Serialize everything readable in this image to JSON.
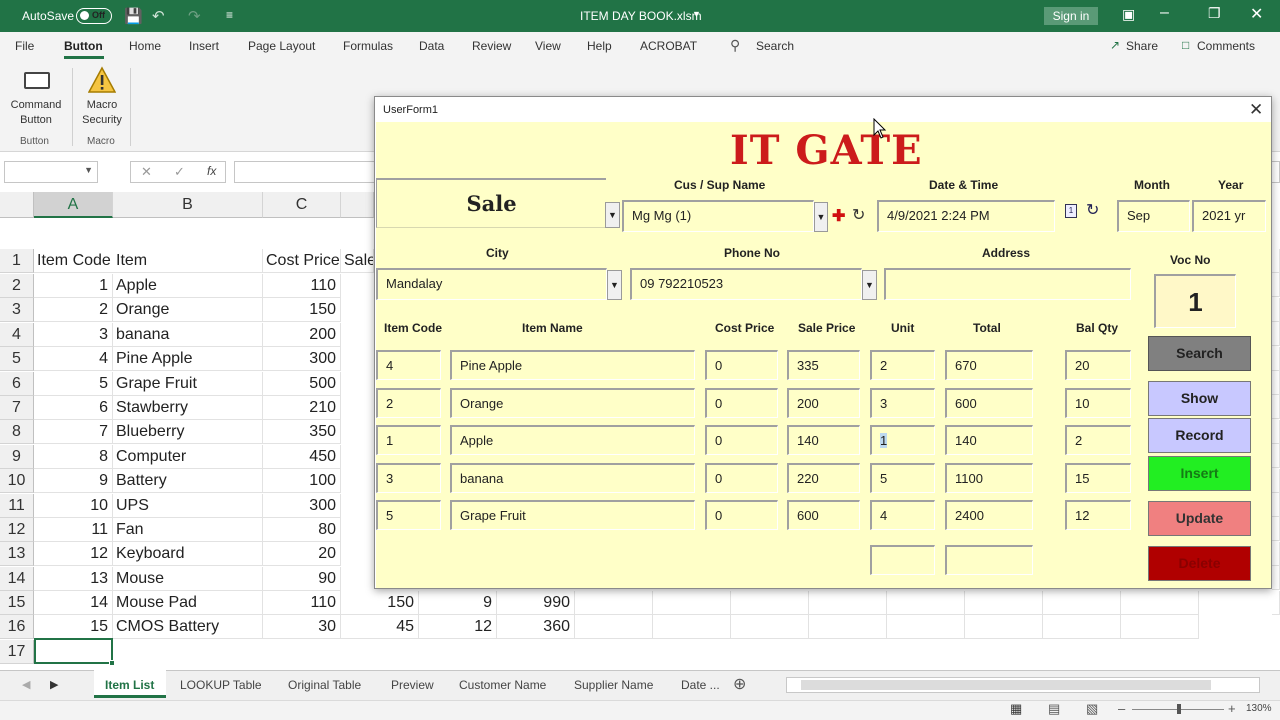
{
  "titlebar": {
    "autosave_label": "AutoSave",
    "autosave_state": "Off",
    "filename": "ITEM DAY BOOK.xlsm",
    "signin_label": "Sign in"
  },
  "ribbon_tabs": [
    "File",
    "Button",
    "Home",
    "Insert",
    "Page Layout",
    "Formulas",
    "Data",
    "Review",
    "View",
    "Help",
    "ACROBAT"
  ],
  "ribbon_search": "Search",
  "share_label": "Share",
  "comments_label": "Comments",
  "ribbon": {
    "command_button_label": "Command Button",
    "command_button_l1": "Command",
    "command_button_l2": "Button",
    "macro_security_l1": "Macro",
    "macro_security_l2": "Security",
    "group_button": "Button",
    "group_macro": "Macro"
  },
  "formula_bar": {
    "fx": "fx"
  },
  "columns": [
    "A",
    "B",
    "C"
  ],
  "col_d_header": "Sale",
  "header_row": {
    "a": "Item Code",
    "b": "Item",
    "c": "Cost Price"
  },
  "rows": [
    {
      "n": "2",
      "code": "1",
      "item": "Apple",
      "cost": "110"
    },
    {
      "n": "3",
      "code": "2",
      "item": "Orange",
      "cost": "150"
    },
    {
      "n": "4",
      "code": "3",
      "item": "banana",
      "cost": "200"
    },
    {
      "n": "5",
      "code": "4",
      "item": "Pine Apple",
      "cost": "300"
    },
    {
      "n": "6",
      "code": "5",
      "item": "Grape Fruit",
      "cost": "500"
    },
    {
      "n": "7",
      "code": "6",
      "item": "Stawberry",
      "cost": "210"
    },
    {
      "n": "8",
      "code": "7",
      "item": "Blueberry",
      "cost": "350"
    },
    {
      "n": "9",
      "code": "8",
      "item": "Computer",
      "cost": "450"
    },
    {
      "n": "10",
      "code": "9",
      "item": "Battery",
      "cost": "100"
    },
    {
      "n": "11",
      "code": "10",
      "item": "UPS",
      "cost": "300"
    },
    {
      "n": "12",
      "code": "11",
      "item": "Fan",
      "cost": "80"
    },
    {
      "n": "13",
      "code": "12",
      "item": "Keyboard",
      "cost": "20"
    },
    {
      "n": "14",
      "code": "13",
      "item": "Mouse",
      "cost": "90"
    }
  ],
  "rows_full": [
    {
      "n": "15",
      "code": "14",
      "item": "Mouse Pad",
      "cost": "110",
      "sale": "150",
      "qty": "9",
      "total": "990"
    },
    {
      "n": "16",
      "code": "15",
      "item": "CMOS Battery",
      "cost": "30",
      "sale": "45",
      "qty": "12",
      "total": "360"
    }
  ],
  "row_1": "1",
  "row_17": "17",
  "sheet_tabs": [
    "Item List",
    "LOOKUP Table",
    "Original Table",
    "Preview",
    "Customer Name",
    "Supplier Name",
    "Date ..."
  ],
  "zoom": "130%",
  "userform": {
    "title": "UserForm1",
    "logo": "IT GATE",
    "type_value": "Sale",
    "labels": {
      "cus_sup": "Cus / Sup Name",
      "datetime": "Date & Time",
      "month": "Month",
      "year": "Year",
      "city": "City",
      "phone": "Phone No",
      "address": "Address",
      "voc": "Voc No",
      "item_code": "Item Code",
      "item_name": "Item Name",
      "cost_price": "Cost Price",
      "sale_price": "Sale Price",
      "unit": "Unit",
      "total": "Total",
      "bal_qty": "Bal Qty"
    },
    "values": {
      "cus_sup": "Mg Mg (1)",
      "datetime": "4/9/2021 2:24 PM",
      "month": "Sep",
      "year": "2021 yr",
      "city": "Mandalay",
      "phone": "09 792210523",
      "address": "",
      "voc": "1"
    },
    "lines": [
      {
        "code": "4",
        "name": "Pine Apple",
        "cost": "0",
        "sale": "335",
        "unit": "2",
        "total": "670",
        "bal": "20"
      },
      {
        "code": "2",
        "name": "Orange",
        "cost": "0",
        "sale": "200",
        "unit": "3",
        "total": "600",
        "bal": "10"
      },
      {
        "code": "1",
        "name": "Apple",
        "cost": "0",
        "sale": "140",
        "unit": "1",
        "total": "140",
        "bal": "2"
      },
      {
        "code": "3",
        "name": "banana",
        "cost": "0",
        "sale": "220",
        "unit": "5",
        "total": "1100",
        "bal": "15"
      },
      {
        "code": "5",
        "name": "Grape Fruit",
        "cost": "0",
        "sale": "600",
        "unit": "4",
        "total": "2400",
        "bal": "12"
      }
    ],
    "buttons": {
      "search": "Search",
      "show": "Show",
      "record": "Record",
      "insert": "Insert",
      "update": "Update",
      "delete": "Delete"
    },
    "colors": {
      "form_bg": "#ffffc8",
      "logo": "#cc1b1b",
      "search": "#808080",
      "show": "#c8c8ff",
      "record": "#c8c8ff",
      "insert": "#22ee22",
      "update": "#f08080",
      "delete": "#b00000"
    }
  }
}
